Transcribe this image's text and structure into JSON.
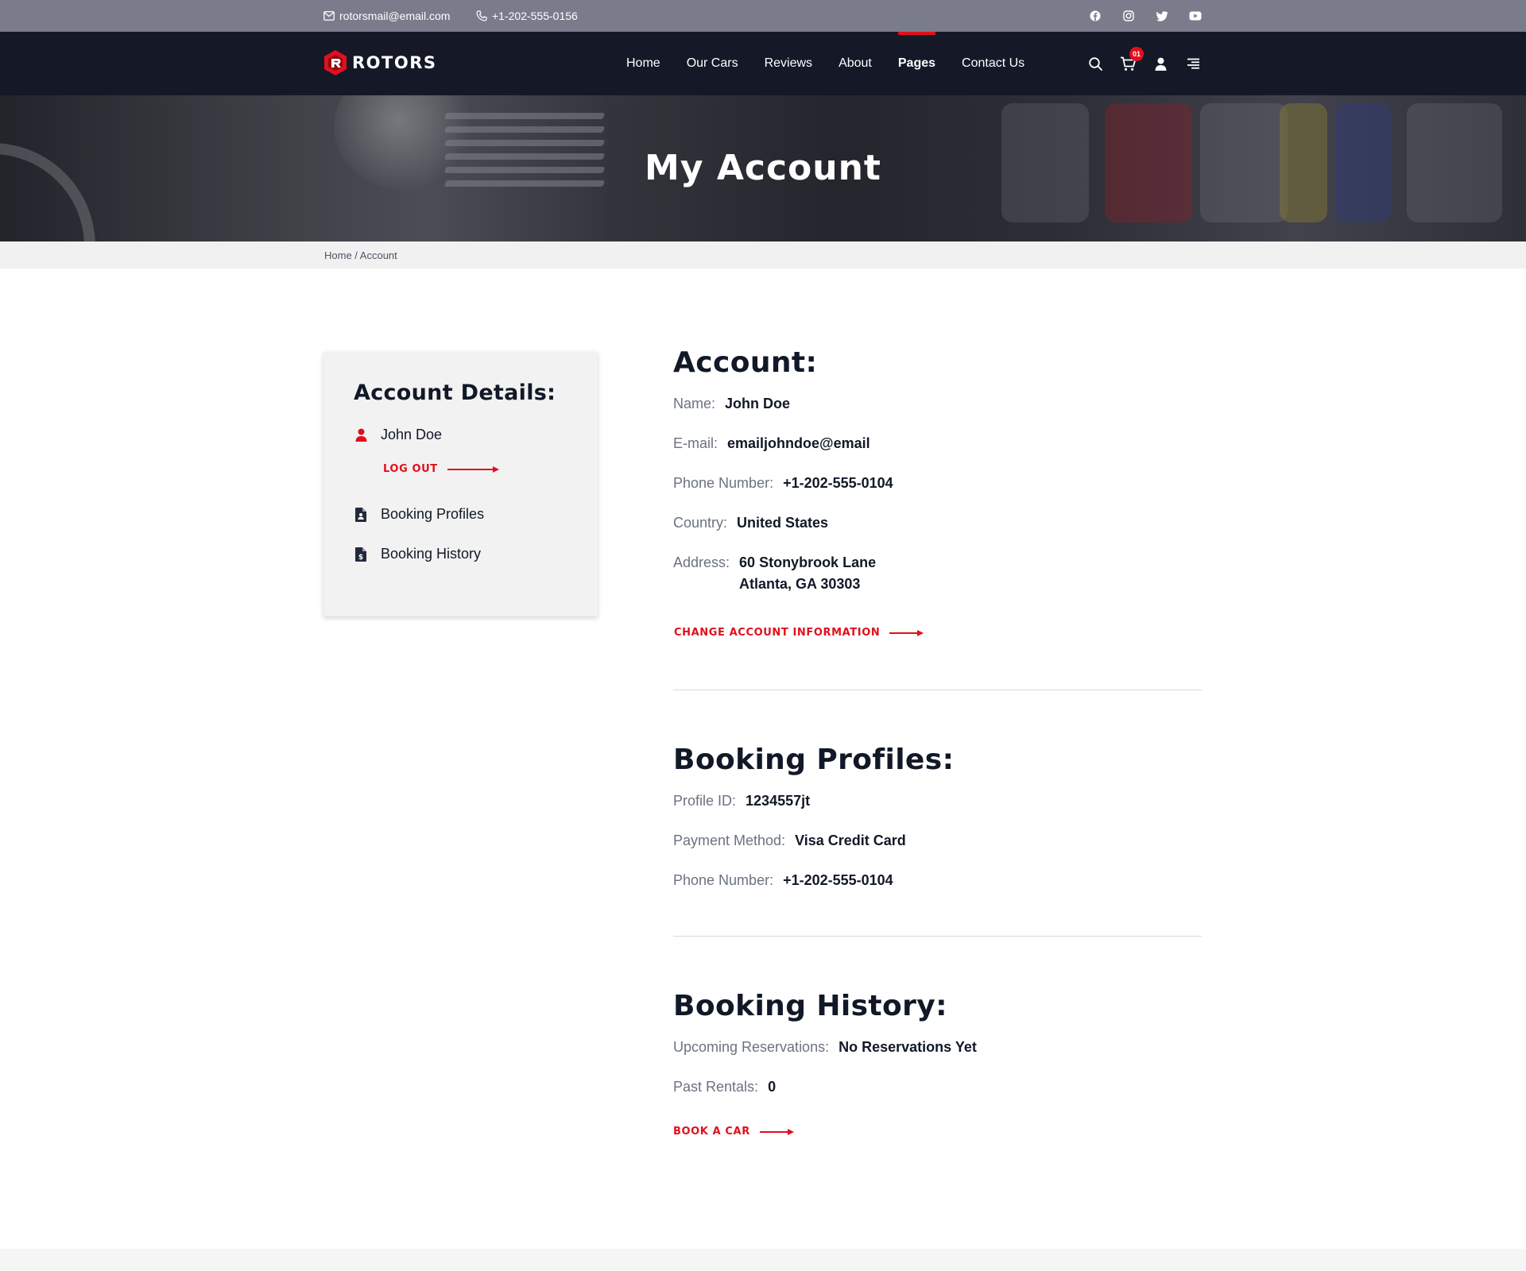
{
  "topbar": {
    "email": "rotorsmail@email.com",
    "phone": "+1-202-555-0156",
    "socials": [
      "facebook-icon",
      "instagram-icon",
      "twitter-icon",
      "youtube-icon"
    ]
  },
  "nav": {
    "brand": "ROTORS",
    "items": [
      {
        "label": "Home"
      },
      {
        "label": "Our Cars"
      },
      {
        "label": "Reviews"
      },
      {
        "label": "About"
      },
      {
        "label": "Pages",
        "active": true
      },
      {
        "label": "Contact Us"
      }
    ],
    "cart_count": "01"
  },
  "hero": {
    "title": "My Account"
  },
  "breadcrumb": {
    "text": "Home / Account"
  },
  "sidebar": {
    "title": "Account Details:",
    "user": "John Doe",
    "logout": "LOG OUT",
    "links": [
      {
        "label": "Booking Profiles"
      },
      {
        "label": "Booking History"
      }
    ]
  },
  "account": {
    "title": "Account:",
    "fields": [
      {
        "label": "Name:",
        "value": "John Doe"
      },
      {
        "label": "E-mail:",
        "value": "emailjohndoe@email"
      },
      {
        "label": "Phone Number:",
        "value": "+1-202-555-0104"
      },
      {
        "label": "Country:",
        "value": "United States"
      },
      {
        "label": "Address:",
        "value": "60 Stonybrook Lane",
        "value2": "Atlanta, GA 30303"
      }
    ],
    "cta": "CHANGE ACCOUNT INFORMATION"
  },
  "profiles": {
    "title": "Booking Profiles:",
    "fields": [
      {
        "label": "Profile ID:",
        "value": "1234557jt"
      },
      {
        "label": "Payment Method:",
        "value": "Visa Credit Card"
      },
      {
        "label": "Phone Number:",
        "value": "+1-202-555-0104"
      }
    ]
  },
  "history": {
    "title": "Booking History:",
    "fields": [
      {
        "label": "Upcoming Reservations:",
        "value": "No Reservations Yet"
      },
      {
        "label": "Past Rentals:",
        "value": "0"
      }
    ],
    "cta": "BOOK A CAR"
  },
  "colors": {
    "accent": "#e0101c",
    "nav_bg": "#151827",
    "topbar_bg": "#7a7c8c"
  }
}
